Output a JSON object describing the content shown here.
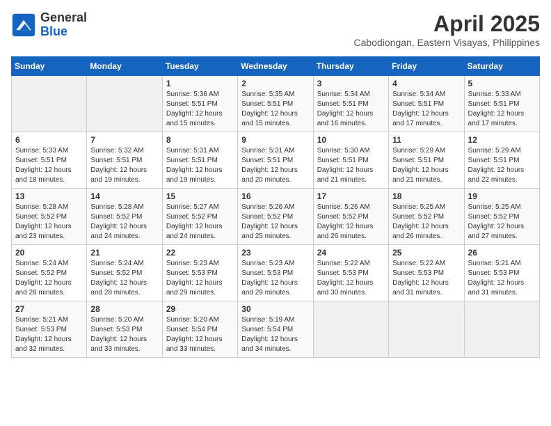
{
  "header": {
    "logo_general": "General",
    "logo_blue": "Blue",
    "month": "April 2025",
    "location": "Cabodiongan, Eastern Visayas, Philippines"
  },
  "days_of_week": [
    "Sunday",
    "Monday",
    "Tuesday",
    "Wednesday",
    "Thursday",
    "Friday",
    "Saturday"
  ],
  "weeks": [
    [
      {
        "day": "",
        "info": ""
      },
      {
        "day": "",
        "info": ""
      },
      {
        "day": "1",
        "info": "Sunrise: 5:36 AM\nSunset: 5:51 PM\nDaylight: 12 hours and 15 minutes."
      },
      {
        "day": "2",
        "info": "Sunrise: 5:35 AM\nSunset: 5:51 PM\nDaylight: 12 hours and 15 minutes."
      },
      {
        "day": "3",
        "info": "Sunrise: 5:34 AM\nSunset: 5:51 PM\nDaylight: 12 hours and 16 minutes."
      },
      {
        "day": "4",
        "info": "Sunrise: 5:34 AM\nSunset: 5:51 PM\nDaylight: 12 hours and 17 minutes."
      },
      {
        "day": "5",
        "info": "Sunrise: 5:33 AM\nSunset: 5:51 PM\nDaylight: 12 hours and 17 minutes."
      }
    ],
    [
      {
        "day": "6",
        "info": "Sunrise: 5:33 AM\nSunset: 5:51 PM\nDaylight: 12 hours and 18 minutes."
      },
      {
        "day": "7",
        "info": "Sunrise: 5:32 AM\nSunset: 5:51 PM\nDaylight: 12 hours and 19 minutes."
      },
      {
        "day": "8",
        "info": "Sunrise: 5:31 AM\nSunset: 5:51 PM\nDaylight: 12 hours and 19 minutes."
      },
      {
        "day": "9",
        "info": "Sunrise: 5:31 AM\nSunset: 5:51 PM\nDaylight: 12 hours and 20 minutes."
      },
      {
        "day": "10",
        "info": "Sunrise: 5:30 AM\nSunset: 5:51 PM\nDaylight: 12 hours and 21 minutes."
      },
      {
        "day": "11",
        "info": "Sunrise: 5:29 AM\nSunset: 5:51 PM\nDaylight: 12 hours and 21 minutes."
      },
      {
        "day": "12",
        "info": "Sunrise: 5:29 AM\nSunset: 5:51 PM\nDaylight: 12 hours and 22 minutes."
      }
    ],
    [
      {
        "day": "13",
        "info": "Sunrise: 5:28 AM\nSunset: 5:52 PM\nDaylight: 12 hours and 23 minutes."
      },
      {
        "day": "14",
        "info": "Sunrise: 5:28 AM\nSunset: 5:52 PM\nDaylight: 12 hours and 24 minutes."
      },
      {
        "day": "15",
        "info": "Sunrise: 5:27 AM\nSunset: 5:52 PM\nDaylight: 12 hours and 24 minutes."
      },
      {
        "day": "16",
        "info": "Sunrise: 5:26 AM\nSunset: 5:52 PM\nDaylight: 12 hours and 25 minutes."
      },
      {
        "day": "17",
        "info": "Sunrise: 5:26 AM\nSunset: 5:52 PM\nDaylight: 12 hours and 26 minutes."
      },
      {
        "day": "18",
        "info": "Sunrise: 5:25 AM\nSunset: 5:52 PM\nDaylight: 12 hours and 26 minutes."
      },
      {
        "day": "19",
        "info": "Sunrise: 5:25 AM\nSunset: 5:52 PM\nDaylight: 12 hours and 27 minutes."
      }
    ],
    [
      {
        "day": "20",
        "info": "Sunrise: 5:24 AM\nSunset: 5:52 PM\nDaylight: 12 hours and 28 minutes."
      },
      {
        "day": "21",
        "info": "Sunrise: 5:24 AM\nSunset: 5:52 PM\nDaylight: 12 hours and 28 minutes."
      },
      {
        "day": "22",
        "info": "Sunrise: 5:23 AM\nSunset: 5:53 PM\nDaylight: 12 hours and 29 minutes."
      },
      {
        "day": "23",
        "info": "Sunrise: 5:23 AM\nSunset: 5:53 PM\nDaylight: 12 hours and 29 minutes."
      },
      {
        "day": "24",
        "info": "Sunrise: 5:22 AM\nSunset: 5:53 PM\nDaylight: 12 hours and 30 minutes."
      },
      {
        "day": "25",
        "info": "Sunrise: 5:22 AM\nSunset: 5:53 PM\nDaylight: 12 hours and 31 minutes."
      },
      {
        "day": "26",
        "info": "Sunrise: 5:21 AM\nSunset: 5:53 PM\nDaylight: 12 hours and 31 minutes."
      }
    ],
    [
      {
        "day": "27",
        "info": "Sunrise: 5:21 AM\nSunset: 5:53 PM\nDaylight: 12 hours and 32 minutes."
      },
      {
        "day": "28",
        "info": "Sunrise: 5:20 AM\nSunset: 5:53 PM\nDaylight: 12 hours and 33 minutes."
      },
      {
        "day": "29",
        "info": "Sunrise: 5:20 AM\nSunset: 5:54 PM\nDaylight: 12 hours and 33 minutes."
      },
      {
        "day": "30",
        "info": "Sunrise: 5:19 AM\nSunset: 5:54 PM\nDaylight: 12 hours and 34 minutes."
      },
      {
        "day": "",
        "info": ""
      },
      {
        "day": "",
        "info": ""
      },
      {
        "day": "",
        "info": ""
      }
    ]
  ]
}
